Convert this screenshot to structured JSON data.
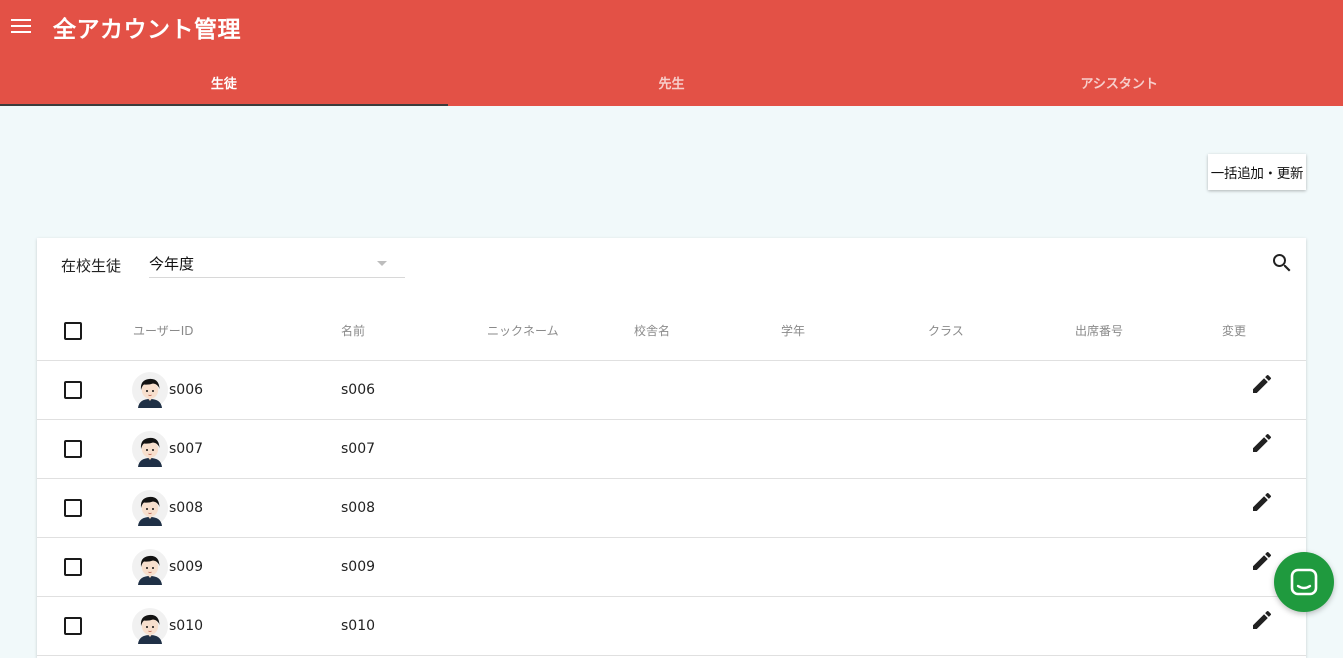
{
  "header": {
    "title": "全アカウント管理",
    "menu_icon": "hamburger-menu-icon"
  },
  "tabs": [
    {
      "label": "生徒",
      "active": true
    },
    {
      "label": "先生",
      "active": false
    },
    {
      "label": "アシスタント",
      "active": false
    }
  ],
  "toolbar": {
    "bulk_button_label": "一括追加・更新"
  },
  "filter": {
    "label": "在校生徒",
    "selected": "今年度"
  },
  "table": {
    "headers": {
      "user_id": "ユーザーID",
      "name": "名前",
      "nickname": "ニックネーム",
      "school": "校舎名",
      "grade": "学年",
      "class": "クラス",
      "number": "出席番号",
      "edit": "変更"
    },
    "rows": [
      {
        "user_id": "s006",
        "name": "s006",
        "nickname": "",
        "school": "",
        "grade": "",
        "class": "",
        "number": ""
      },
      {
        "user_id": "s007",
        "name": "s007",
        "nickname": "",
        "school": "",
        "grade": "",
        "class": "",
        "number": ""
      },
      {
        "user_id": "s008",
        "name": "s008",
        "nickname": "",
        "school": "",
        "grade": "",
        "class": "",
        "number": ""
      },
      {
        "user_id": "s009",
        "name": "s009",
        "nickname": "",
        "school": "",
        "grade": "",
        "class": "",
        "number": ""
      },
      {
        "user_id": "s010",
        "name": "s010",
        "nickname": "",
        "school": "",
        "grade": "",
        "class": "",
        "number": ""
      }
    ]
  },
  "colors": {
    "primary": "#e35146",
    "background": "#f1f9fa",
    "chat_fab": "#1f9a3e"
  }
}
